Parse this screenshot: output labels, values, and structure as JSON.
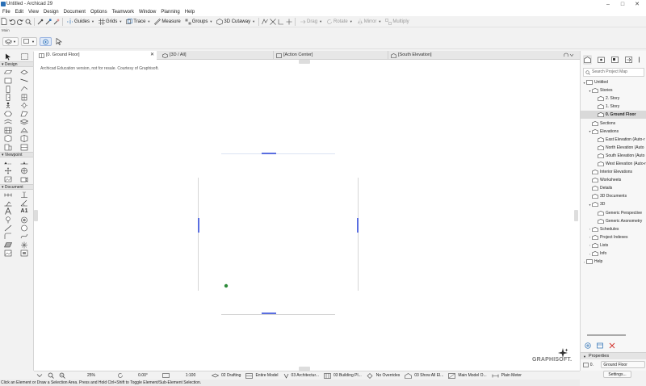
{
  "window": {
    "title": "Untitled - Archicad 29",
    "controls": [
      "–",
      "□",
      "✕"
    ]
  },
  "menu": [
    "File",
    "Edit",
    "View",
    "Design",
    "Document",
    "Options",
    "Teamwork",
    "Window",
    "Planning",
    "Help"
  ],
  "toolbar1": {
    "guides": "Guides",
    "grids": "Grids",
    "trace": "Trace",
    "measure": "Measure",
    "groups": "Groups",
    "cutaway": "3D Cutaway",
    "drag": "Drag",
    "rotate": "Rotate",
    "mirror": "Mirror",
    "multiply": "Multiply"
  },
  "toolbar2": {
    "label": "Main"
  },
  "toolbox": {
    "sections": [
      "Design",
      "Viewpoint",
      "Document"
    ],
    "text_tool": "A1"
  },
  "tabs": [
    {
      "label": "[0. Ground Floor]",
      "active": true
    },
    {
      "label": "[3D / All]",
      "active": false
    },
    {
      "label": "[Action Center]",
      "active": false
    },
    {
      "label": "[South Elevation]",
      "active": false
    }
  ],
  "canvas": {
    "notice": "Archicad Education version, not for resale. Courtesy of Graphisoft.",
    "logo": "GRAPHISOFT."
  },
  "navigator": {
    "search_placeholder": "Search Project Map",
    "tree": [
      {
        "label": "Untitled",
        "level": 0,
        "twisty": "▾"
      },
      {
        "label": "Stories",
        "level": 1,
        "twisty": "▾"
      },
      {
        "label": "2. Story",
        "level": 2,
        "twisty": ""
      },
      {
        "label": "1. Story",
        "level": 2,
        "twisty": ""
      },
      {
        "label": "0. Ground Floor",
        "level": 2,
        "twisty": "",
        "selected": true
      },
      {
        "label": "Sections",
        "level": 1,
        "twisty": ""
      },
      {
        "label": "Elevations",
        "level": 1,
        "twisty": "▾"
      },
      {
        "label": "East Elevation (Auto-r",
        "level": 2,
        "twisty": ""
      },
      {
        "label": "North Elevation (Auto",
        "level": 2,
        "twisty": ""
      },
      {
        "label": "South Elevation (Auto",
        "level": 2,
        "twisty": ""
      },
      {
        "label": "West Elevation (Auto-r",
        "level": 2,
        "twisty": ""
      },
      {
        "label": "Interior Elevations",
        "level": 1,
        "twisty": ""
      },
      {
        "label": "Worksheets",
        "level": 1,
        "twisty": ""
      },
      {
        "label": "Details",
        "level": 1,
        "twisty": ""
      },
      {
        "label": "3D Documents",
        "level": 1,
        "twisty": ""
      },
      {
        "label": "3D",
        "level": 1,
        "twisty": "▾"
      },
      {
        "label": "Generic Perspective",
        "level": 2,
        "twisty": ""
      },
      {
        "label": "Generic Axonometry",
        "level": 2,
        "twisty": ""
      },
      {
        "label": "Schedules",
        "level": 1,
        "twisty": "›"
      },
      {
        "label": "Project Indexes",
        "level": 1,
        "twisty": "›"
      },
      {
        "label": "Lists",
        "level": 1,
        "twisty": "›"
      },
      {
        "label": "Info",
        "level": 1,
        "twisty": "›"
      },
      {
        "label": "Help",
        "level": 0,
        "twisty": "›"
      }
    ],
    "properties_title": "Properties",
    "properties_id": "0.",
    "properties_name": "Ground Floor",
    "settings_label": "Settings..."
  },
  "bottombar": {
    "zoom": "25%",
    "angle": "0.00°",
    "scale": "1:100",
    "layer_combo": "02 Drafting",
    "model_view": "Entire Model",
    "pen_set": "03 Architectur...",
    "model_options": "03 Building Pl...",
    "overrides": "No Overrides",
    "renovation": "03 Show All El...",
    "dimension": "Main Model O...",
    "display": "Plain Meter"
  },
  "status": "Click an Element or Draw a Selection Area. Press and Hold Ctrl+Shift to Toggle Element/Sub-Element Selection.",
  "colors": {
    "accent": "#2a6fb5",
    "selection_blue": "#5a6ee0",
    "green_dot": "#2e8b3a",
    "delete_red": "#d0302a"
  }
}
